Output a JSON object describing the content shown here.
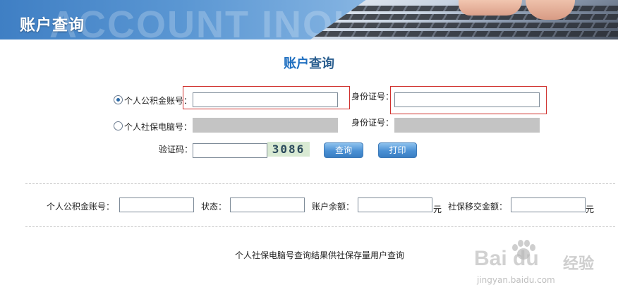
{
  "banner": {
    "title": "账户查询",
    "bg_text": "ACCOUNT INQUIRY"
  },
  "page_title": {
    "part1": "账户",
    "part2": "查询"
  },
  "form": {
    "radio_fund": {
      "label": "个人公积金账号：",
      "checked": true
    },
    "radio_social": {
      "label": "个人社保电脑号：",
      "checked": false
    },
    "id_label_1": "身份证号：",
    "id_label_2": "身份证号：",
    "captcha_label": "验证码：",
    "captcha_code": "3086",
    "query_button": "查询",
    "print_button": "打印"
  },
  "results": {
    "fund_account_label": "个人公积金账号：",
    "status_label": "状态：",
    "balance_label": "账户余额：",
    "balance_unit": "元",
    "transfer_label": "社保移交金额：",
    "transfer_unit": "元"
  },
  "note": "个人社保电脑号查询结果供社保存量用户查询",
  "watermark": {
    "logo": "Bai du",
    "brand": "经验",
    "url": "jingyan.baidu.com"
  },
  "colors": {
    "accent": "#2a5e8f",
    "highlight_border": "#d0302d",
    "button": "#4a90d4"
  }
}
